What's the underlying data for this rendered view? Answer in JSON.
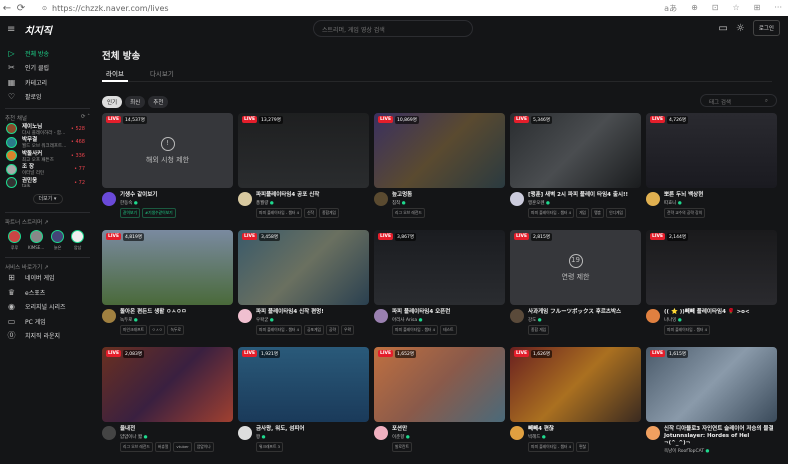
{
  "browser": {
    "url": "https://chzzk.naver.com/lives",
    "back": "←",
    "reload": "⟳",
    "lock": "🔒",
    "icons": [
      "aあ",
      "⊕",
      "⊡",
      "☆",
      "⊞",
      "···"
    ]
  },
  "header": {
    "logo": "치지직",
    "search_placeholder": "스트리머, 게임 영상 검색",
    "login": "로그인"
  },
  "sidebar": {
    "nav": [
      {
        "label": "전체 방송",
        "icon": "▷"
      },
      {
        "label": "인기 클립",
        "icon": "✂"
      },
      {
        "label": "카테고리",
        "icon": "▦"
      },
      {
        "label": "팔로잉",
        "icon": "♡"
      }
    ],
    "recommended_title": "추천 채널",
    "channels": [
      {
        "name": "제이노님",
        "sub": "다시 플레이하라 - 함...",
        "viewers": "• 528",
        "color": "#8a4a2a"
      },
      {
        "name": "박무결",
        "sub": "월드 오브 워크래프트...",
        "viewers": "• 468",
        "color": "#2a7a8a"
      },
      {
        "name": "박돌사커",
        "sub": "최고 오프 패튼즈",
        "viewers": "• 336",
        "color": "#d9822b"
      },
      {
        "name": "조 장",
        "sub": "이터널 리턴",
        "viewers": "• 77",
        "color": "#aaa"
      },
      {
        "name": "권민웅",
        "sub": "talk",
        "viewers": "• 72",
        "color": "#333"
      }
    ],
    "more": "더보기 ▾",
    "partners_title": "파트너 스트리머 ↗",
    "partners": [
      {
        "name": "루루",
        "color": "#c44"
      },
      {
        "name": "KIMSE...",
        "color": "#888"
      },
      {
        "name": "늙은",
        "color": "#447"
      },
      {
        "name": "얍삽",
        "color": "#eee"
      }
    ],
    "services_title": "서비스 바로가기 ↗",
    "services": [
      {
        "label": "네이버 게임",
        "icon": "⊞"
      },
      {
        "label": "e스포츠",
        "icon": "♛"
      },
      {
        "label": "오리지널 시리즈",
        "icon": "◉"
      },
      {
        "label": "PC 게임",
        "icon": "▭"
      },
      {
        "label": "치지직 라운지",
        "icon": "⓪"
      }
    ]
  },
  "main": {
    "title": "전체 방송",
    "tabs": [
      "라이브",
      "다시보기"
    ],
    "chips": [
      "인기",
      "최신",
      "추천"
    ],
    "tag_search_placeholder": "태그 검색",
    "live_label": "LIVE",
    "cards": [
      {
        "viewers": "14,537명",
        "title": "기생수 같이보기",
        "streamer": "한동숙",
        "tags": [
          "같이보기",
          "#기생수같이보기"
        ],
        "green": true,
        "overlay": "해외 시청 제한",
        "overlay_icon": "!",
        "bg": "#36373b",
        "av": "#6a4ad9"
      },
      {
        "viewers": "13,279명",
        "title": "파피플레이타임4 공포 신작",
        "streamer": "풍월량",
        "tags": [
          "파피 플레이타임 - 챕터 4",
          "신작",
          "종합게임"
        ],
        "bg": "linear-gradient(#1e1f20,#2a2c2e)",
        "av": "#d8c9a0"
      },
      {
        "viewers": "10,869명",
        "title": "늪고멍돔",
        "streamer": "침착",
        "tags": [
          "리그 오브 레전드"
        ],
        "bg": "linear-gradient(135deg,#3a3060,#5a4a30,#2a3a40)",
        "av": "#5a4a30"
      },
      {
        "viewers": "5,346명",
        "title": "[맹훈] 새벽 2시 파피 플레이 타임4 출시!!",
        "streamer": "맹훈오렌",
        "tags": [
          "파피 플레이타임 - 챕터 4",
          "게임",
          "맹훈",
          "인디게임"
        ],
        "bg": "linear-gradient(135deg,#2a2d30,#4a4d50,#1a1c1e)",
        "av": "#ccd"
      },
      {
        "viewers": "4,726명",
        "title": "뽀른 두뇌 백상현",
        "streamer": "따효니",
        "tags": [
          "전략 교수의 공략 강의"
        ],
        "bg": "linear-gradient(#2a2a30,#1a1a20)",
        "av": "#e0b050"
      },
      {
        "viewers": "4,819명",
        "title": "돌아온 편든드 생활 ㅇㅅㅇㅁ",
        "streamer": "녹두로",
        "tags": [
          "마인크래프트",
          "ㅇㅅㅇ",
          "녹두로"
        ],
        "bg": "linear-gradient(#7a8aa0,#4a6a3a)",
        "av": "#a08040"
      },
      {
        "viewers": "3,458명",
        "title": "파피 플레이타임4 신작 편멍!",
        "streamer": "우왁굳",
        "tags": [
          "파피 플레이타임 - 챕터 4",
          "공포게임",
          "공략",
          "우왁"
        ],
        "bg": "linear-gradient(135deg,#3a5a6a,#6a7060,#2a4050)",
        "av": "#f0c0d0"
      },
      {
        "viewers": "3,867명",
        "title": "파피 플레이타임4 오픈런",
        "streamer": "아리사 Arisa",
        "tags": [
          "파피 플레이타임 - 챕터 4",
          "테스트"
        ],
        "bg": "linear-gradient(#1a1c20,#2a2c30)",
        "av": "#9a80b0"
      },
      {
        "viewers": "2,815명",
        "title": "사과게임 フルーツボックス 후르츠박스",
        "streamer": "강도",
        "tags": [
          "종합 게임"
        ],
        "overlay": "연령 제한",
        "overlay_icon": "19",
        "bg": "#36373b",
        "av": "#5a4a3a"
      },
      {
        "viewers": "2,144명",
        "title": "(( ⭐ ))빼빼 플레이타임4 🌹 >o<",
        "streamer": "나나잉",
        "tags": [
          "파피 플레이타임 - 챕터 4"
        ],
        "bg": "linear-gradient(#1a1a1c,#2a2a2e)",
        "av": "#e08040"
      },
      {
        "viewers": "2,083명",
        "title": "율내전",
        "streamer": "얍얍이나 짧",
        "tags": [
          "리그 오브 레전드",
          "버츄얼",
          "vtuber",
          "얍얍이나"
        ],
        "bg": "linear-gradient(135deg,#6a3020,#3a2040,#a04030)",
        "av": "#444"
      },
      {
        "viewers": "1,921명",
        "title": "금사왕, 워도, 섬피어",
        "streamer": "짱",
        "tags": [
          "워크래프트 3"
        ],
        "bg": "linear-gradient(#2a5a7a,#1a3a5a)",
        "av": "#ddd"
      },
      {
        "viewers": "1,652명",
        "title": "포션만",
        "streamer": "이춘향",
        "tags": [
          "발로란트"
        ],
        "bg": "linear-gradient(135deg,#c07040,#8a5a4a,#4a6a7a)",
        "av": "#f0b0c0"
      },
      {
        "viewers": "1,626명",
        "title": "빼빼4 편찮",
        "streamer": "빅헤드",
        "tags": [
          "파피 플레이타임 - 챕터 4",
          "편찮"
        ],
        "bg": "linear-gradient(135deg,#6a2020,#aa7020,#3a2a20)",
        "av": "#e0a040"
      },
      {
        "viewers": "1,615명",
        "title": "신작 디아블로3 자인연트 슬레이어 저승의 물결 Jotunnslayer: Hordes of Hel ¬(^_^)¬",
        "streamer": "옥냥이 RoofTopCAT",
        "tags": [],
        "bg": "linear-gradient(135deg,#4a5a6a,#8a9aaa,#3a4a5a)",
        "av": "#f0a060"
      }
    ]
  }
}
